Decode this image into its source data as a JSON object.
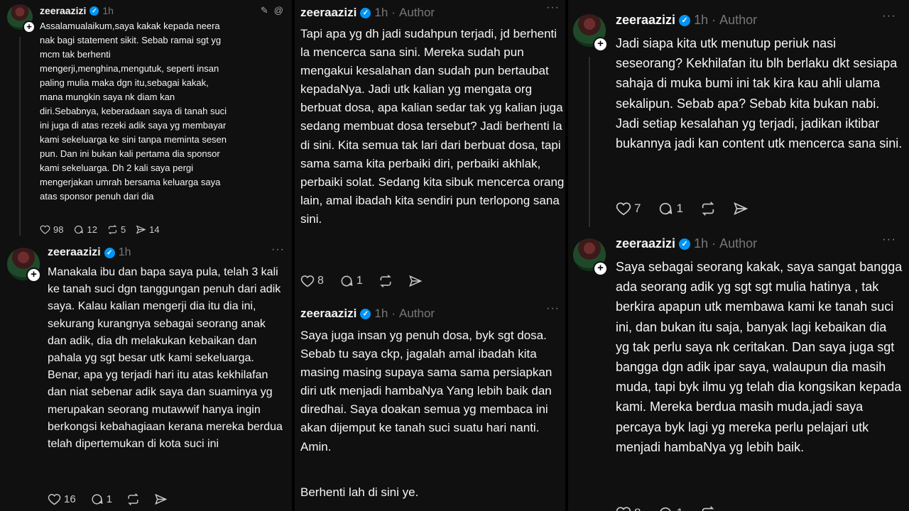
{
  "colors": {
    "background": "#101010",
    "text": "#f3f5f7",
    "muted": "#777777",
    "verified": "#0095f6"
  },
  "posts": [
    {
      "username": "zeeraazizi",
      "time": "1h",
      "body": "Assalamualaikum,saya kakak kepada neera nak bagi statement sikit. Sebab ramai sgt yg mcm tak berhenti mengerji,menghina,mengutuk, seperti insan paling mulia maka dgn itu,sebagai kakak, mana mungkin saya nk diam kan diri.Sebabnya, keberadaan saya di tanah suci ini juga di atas rezeki adik saya yg membayar kami sekeluarga ke sini tanpa meminta sesen pun. Dan ini bukan kali pertama dia sponsor kami sekeluarga. Dh 2 kali saya pergi mengerjakan umrah bersama keluarga saya atas sponsor penuh dari dia",
      "likes": "98",
      "replies": "12",
      "reposts": "5",
      "shares": "14",
      "header_icons": [
        "pencil-icon",
        "threads-icon"
      ]
    },
    {
      "username": "zeeraazizi",
      "time": "1h",
      "body": "Manakala ibu dan bapa saya pula, telah 3 kali ke tanah suci dgn tanggungan penuh dari adik saya. Kalau kalian mengerji dia itu dia ini, sekurang kurangnya sebagai seorang anak dan adik, dia dh melakukan kebaikan dan pahala yg sgt besar utk kami sekeluarga. Benar, apa yg terjadi hari itu atas kekhilafan dan niat sebenar adik saya dan suaminya yg merupakan seorang mutawwif hanya ingin berkongsi kebahagiaan kerana mereka berdua telah dipertemukan di kota suci ini",
      "likes": "16",
      "replies": "1"
    },
    {
      "username": "zeeraazizi",
      "time": "1h",
      "author": "Author",
      "body": "Tapi apa yg dh jadi sudahpun terjadi, jd berhenti la mencerca sana sini. Mereka sudah pun mengakui kesalahan dan sudah pun bertaubat kepadaNya. Jadi utk kalian yg mengata org berbuat dosa, apa kalian sedar tak yg kalian juga sedang membuat dosa tersebut? Jadi berhenti la di sini. Kita semua tak lari dari berbuat dosa, tapi sama sama kita perbaiki diri, perbaiki akhlak, perbaiki solat. Sedang kita sibuk mencerca orang lain, amal ibadah kita sendiri pun terlopong sana sini.",
      "likes": "8",
      "replies": "1"
    },
    {
      "username": "zeeraazizi",
      "time": "1h",
      "author": "Author",
      "body": "Saya juga insan yg penuh dosa, byk sgt dosa. Sebab tu saya ckp, jagalah amal ibadah kita masing masing supaya sama sama persiapkan diri utk menjadi hambaNya Yang lebih baik dan diredhai. Saya doakan semua yg membaca ini akan dijemput ke tanah suci suatu hari nanti. Amin.",
      "body2": "Berhenti lah di sini ye."
    },
    {
      "username": "zeeraazizi",
      "time": "1h",
      "author": "Author",
      "body": "Jadi siapa kita utk menutup periuk nasi seseorang? Kekhilafan itu blh berlaku dkt sesiapa sahaja di muka bumi ini tak kira kau ahli ulama sekalipun. Sebab apa? Sebab kita bukan nabi. Jadi setiap kesalahan yg terjadi, jadikan iktibar bukannya jadi kan content utk mencerca sana sini.",
      "likes": "7",
      "replies": "1"
    },
    {
      "username": "zeeraazizi",
      "time": "1h",
      "author": "Author",
      "body": "Saya sebagai seorang kakak, saya sangat bangga ada seorang adik yg sgt sgt mulia hatinya , tak berkira apapun utk membawa kami ke tanah suci ini, dan bukan itu saja, banyak lagi kebaikan dia yg tak perlu saya nk ceritakan. Dan saya juga sgt bangga dgn adik ipar saya, walaupun dia masih muda, tapi byk ilmu yg telah dia kongsikan kepada kami. Mereka berdua masih muda,jadi saya percaya byk lagi yg mereka perlu pelajari utk menjadi hambaNya yg lebih baik.",
      "likes": "8",
      "replies": "1"
    }
  ]
}
